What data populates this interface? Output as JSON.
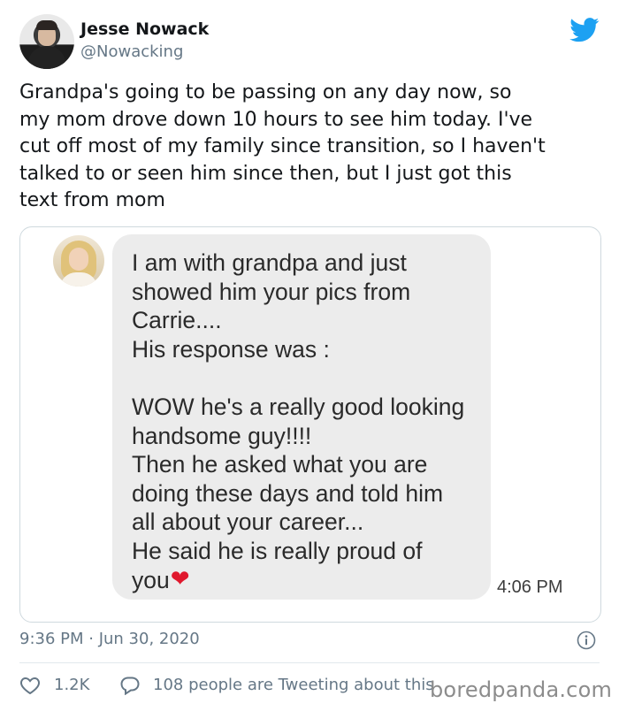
{
  "tweet": {
    "author_name": "Jesse Nowack",
    "author_handle": "@Nowacking",
    "text": "Grandpa's going to be passing on any day now, so\nmy mom drove down 10 hours to see him today. I've\ncut off most of my family since transition, so I haven't\ntalked to or seen him since then, but I just got this\ntext from mom",
    "timestamp": "9:36 PM · Jun 30, 2020",
    "like_count": "1.2K",
    "tweeting_text": "108 people are Tweeting about this",
    "brand_color": "#1da1f2"
  },
  "media": {
    "message_text": "I am with grandpa and just\nshowed him your pics from\nCarrie....\nHis response was :\n\nWOW he's a really good looking\nhandsome guy!!!!\nThen he asked what you are\ndoing these days and told him\nall about your career...\nHe said he is really proud of\nyou",
    "heart_emoji": "❤",
    "message_time": "4:06 PM"
  },
  "watermark": "boredpanda.com",
  "icons": {
    "platform": "twitter-bird-icon",
    "info": "info-icon",
    "like": "heart-icon",
    "reply": "speech-bubble-icon"
  }
}
